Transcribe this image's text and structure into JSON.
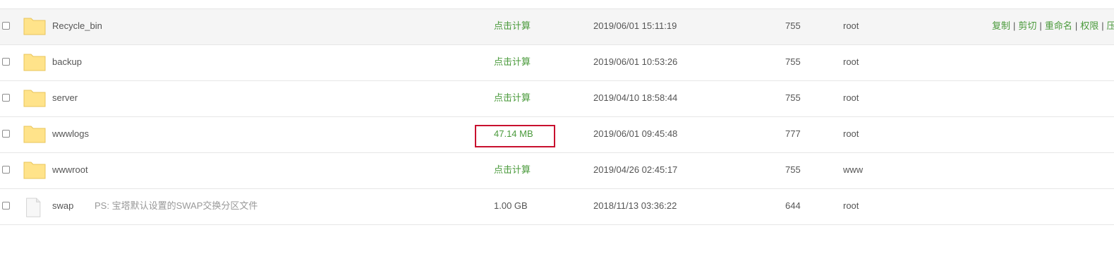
{
  "files": [
    {
      "name": "Recycle_bin",
      "type": "folder",
      "size": "点击计算",
      "mtime": "2019/06/01 15:11:19",
      "perm": "755",
      "owner": "root",
      "ps": ""
    },
    {
      "name": "backup",
      "type": "folder",
      "size": "点击计算",
      "mtime": "2019/06/01 10:53:26",
      "perm": "755",
      "owner": "root",
      "ps": ""
    },
    {
      "name": "server",
      "type": "folder",
      "size": "点击计算",
      "mtime": "2019/04/10 18:58:44",
      "perm": "755",
      "owner": "root",
      "ps": ""
    },
    {
      "name": "wwwlogs",
      "type": "folder",
      "size": "47.14 MB",
      "mtime": "2019/06/01 09:45:48",
      "perm": "777",
      "owner": "root",
      "ps": ""
    },
    {
      "name": "wwwroot",
      "type": "folder",
      "size": "点击计算",
      "mtime": "2019/04/26 02:45:17",
      "perm": "755",
      "owner": "www",
      "ps": ""
    },
    {
      "name": "swap",
      "type": "file",
      "size": "1.00 GB",
      "mtime": "2018/11/13 03:36:22",
      "perm": "644",
      "owner": "root",
      "ps": "PS: 宝塔默认设置的SWAP交换分区文件"
    }
  ],
  "row_actions": [
    "复制",
    "剪切",
    "重命名",
    "权限",
    "压"
  ],
  "colors": {
    "accent_green": "#4a9a3b",
    "highlight_red": "#c8102e",
    "folder_yellow": "#ffe38a"
  },
  "icons": {
    "folder": "folder-icon",
    "file": "file-icon"
  }
}
